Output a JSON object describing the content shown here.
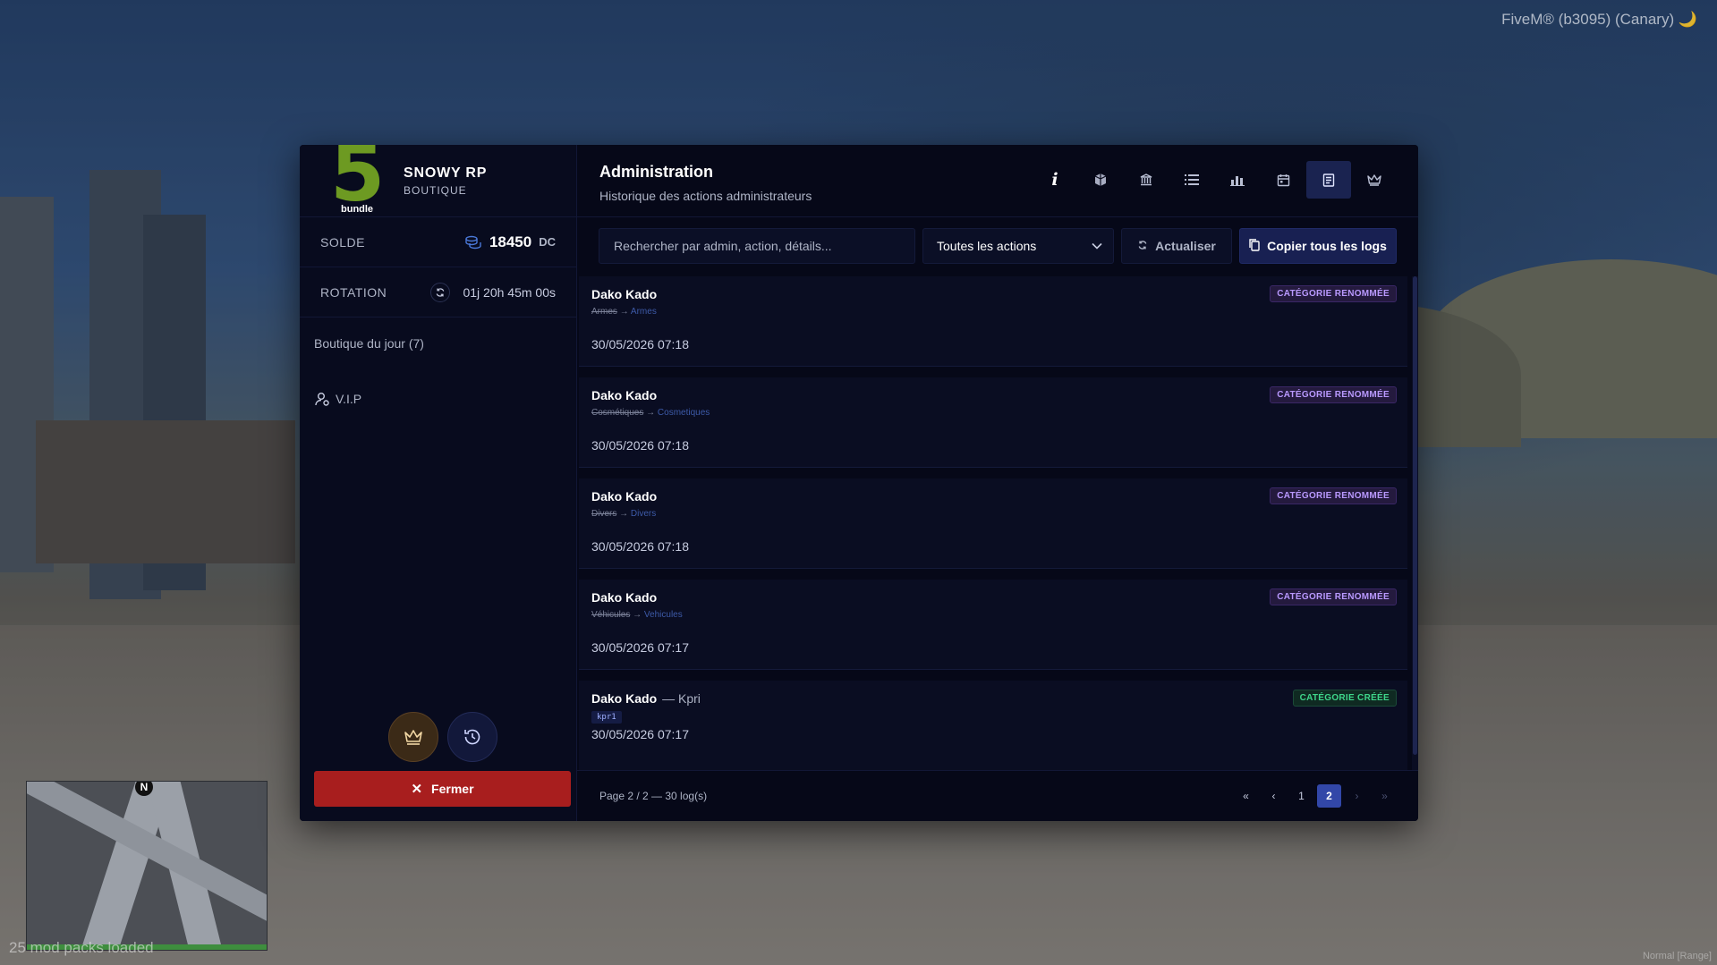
{
  "overlay": {
    "fivem_label": "FiveM® (b3095) (Canary) 🌙",
    "mod_packs": "25 mod packs loaded",
    "minimap_north": "N",
    "corner_text": "Normal [Range]"
  },
  "brand": {
    "logo_number": "5",
    "logo_word": "bundle",
    "name": "SNOWY RP",
    "subtitle": "BOUTIQUE"
  },
  "sidebar": {
    "balance_label": "SOLDE",
    "balance_value": "18450",
    "balance_currency": "DC",
    "rotation_label": "ROTATION",
    "rotation_value": "01j 20h 45m 00s",
    "nav": [
      {
        "label": "Boutique du jour (7)"
      },
      {
        "label": "V.I.P"
      }
    ],
    "close_label": "Fermer"
  },
  "header": {
    "title": "Administration",
    "subtitle": "Historique des actions administrateurs",
    "info_glyph": "i"
  },
  "toolbar": {
    "search_placeholder": "Rechercher par admin, action, détails...",
    "filter_value": "Toutes les actions",
    "refresh_label": "Actualiser",
    "copy_label": "Copier tous les logs"
  },
  "logs": [
    {
      "admin": "Dako Kado",
      "extra": "",
      "old": "Armes",
      "arrow": "→",
      "new": "Armes",
      "tag": "",
      "date": "30/05/2026 07:18",
      "badge": "CATÉGORIE RENOMMÉE"
    },
    {
      "admin": "Dako Kado",
      "extra": "",
      "old": "Cosmétiques",
      "arrow": "→",
      "new": "Cosmetiques",
      "tag": "",
      "date": "30/05/2026 07:18",
      "badge": "CATÉGORIE RENOMMÉE"
    },
    {
      "admin": "Dako Kado",
      "extra": "",
      "old": "Divers",
      "arrow": "→",
      "new": "Divers",
      "tag": "",
      "date": "30/05/2026 07:18",
      "badge": "CATÉGORIE RENOMMÉE"
    },
    {
      "admin": "Dako Kado",
      "extra": "",
      "old": "Véhicules",
      "arrow": "→",
      "new": "Vehicules",
      "tag": "",
      "date": "30/05/2026 07:17",
      "badge": "CATÉGORIE RENOMMÉE"
    },
    {
      "admin": "Dako Kado",
      "extra": "— Kpri",
      "old": "",
      "arrow": "",
      "new": "",
      "tag": "kpr1",
      "date": "30/05/2026 07:17",
      "badge": "CATÉGORIE CRÉÉE"
    }
  ],
  "pagination": {
    "info": "Page 2 / 2 — 30 log(s)",
    "first": "«",
    "prev": "‹",
    "pages": [
      "1",
      "2"
    ],
    "next": "›",
    "last": "»",
    "current": "2"
  },
  "colors": {
    "accent": "#3247a8",
    "danger": "#a81e1e",
    "badge_renamed": "#b999ff",
    "badge_created": "#3ed68a",
    "logo_green": "#6d9a22"
  }
}
